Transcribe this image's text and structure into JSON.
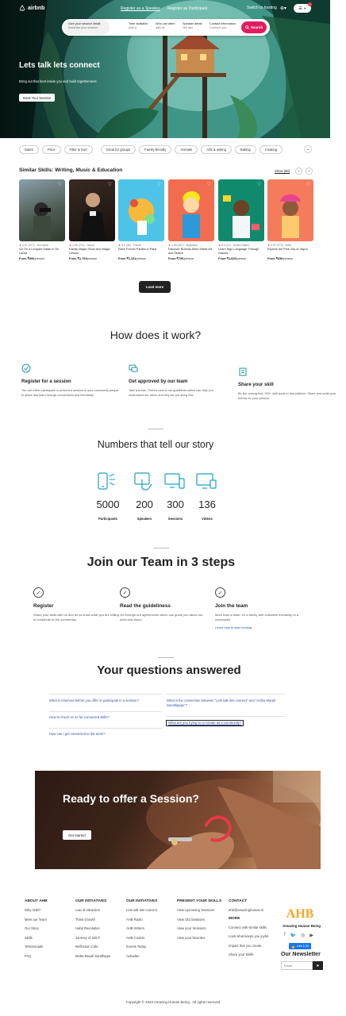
{
  "nav": {
    "logo_text": "airbnb",
    "register_speaker": "Register as a Speaker",
    "register_participant": "Register as Participant",
    "switch_hosting": "Switch to hosting",
    "globe": "⊕",
    "menu": "☰",
    "user": "●"
  },
  "search": {
    "seg1_title": "Give your session detail",
    "seg1_sub": "Describe your session",
    "seg2_title": "Time available",
    "seg2_sub": "Add d",
    "seg3_title": "Who can atten",
    "seg3_sub": "add de",
    "seg4_title": "Speaker detail",
    "seg4_sub": "Tell abo",
    "seg5_title": "Contact information",
    "seg5_sub": "Connect you",
    "button": "Search"
  },
  "hero": {
    "title": "Lets talk lets connect",
    "subtitle": "Bring out that best inside you and build togetherness",
    "button": "Book Your Session"
  },
  "filters": [
    "Dates",
    "Price",
    "Filter & Sort",
    "Great for groups",
    "Family-friendly",
    "Animals",
    "Arts & writing",
    "Baking",
    "Cooking"
  ],
  "similar": {
    "title": "Similar Skills: Writing, Music & Education",
    "show_all": "Show (68)",
    "cards": [
      {
        "meta": "4.97 (377) · Sri Lanka",
        "title": "Go On a Leopard Safari in Sri Lanka",
        "price_bold": "From ₹906",
        "price_rest": "/person"
      },
      {
        "meta": "4.96 (274) · Japan",
        "title": "Family Magic Show And Magic Lesson",
        "price_bold": "From ₹1,793",
        "price_rest": "/person"
      },
      {
        "meta": "5.0 (35) · France",
        "title": "Rave French Parties in Paris",
        "price_bold": "From ₹1,331",
        "price_rest": "/person"
      },
      {
        "meta": "4.98 (287) · Argentina",
        "title": "Discover Buenos Aires Street Art and Sketch",
        "price_bold": "From ₹796",
        "price_rest": "/person"
      },
      {
        "meta": "5.0 (21) · United States",
        "title": "Learn Sign Language Through Games",
        "price_bold": "From ₹1,829",
        "price_rest": "/person"
      },
      {
        "meta": "4.97 (273) · India",
        "title": "Explore the Pink City of Jaipur",
        "price_bold": "From ₹656",
        "price_rest": "/person"
      }
    ],
    "load_more": "Load more"
  },
  "how": {
    "title": "How does it work?",
    "items": [
      {
        "title": "Register for a session",
        "text": "You can either participate or present a session to your community people to share and learn through connections and friendship."
      },
      {
        "title": "Get approved by our team",
        "text": "Take a break. There's next to our guidelines which can help you understand our vision and why we are doing this."
      },
      {
        "title": "Share your skill",
        "text": "Be like among that, 300+ skill spots in this platform. Share and invite your friends for your session."
      }
    ]
  },
  "numbers": {
    "title": "Numbers that tell our story",
    "items": [
      {
        "value": "5000",
        "label": "Participants"
      },
      {
        "value": "200",
        "label": "Speakers"
      },
      {
        "value": "300",
        "label": "Sessions"
      },
      {
        "value": "136",
        "label": "Videos"
      }
    ]
  },
  "join": {
    "title": "Join our Team in 3 steps",
    "steps": [
      {
        "title": "Register",
        "text": "Share your skills with us and let us know what you are willing to contribute to the community."
      },
      {
        "title": "Read the guideliness",
        "text": "Go through our agreements which can guide you about our work and vision."
      },
      {
        "title": "Join the team",
        "text": "More than a team, it's a family with collective friendship in a community",
        "link": "Learn how to start hosting"
      }
    ]
  },
  "faq": {
    "title": "Your questions answered",
    "q1": "What is reserved before you offer or participate in a session?",
    "q2": "What is the connection between \"Lets talk lets connect\" and \"Antha Maadi Sandhipppu\"?",
    "q3": "How to check on so far connected skills?",
    "q4": "What are you trying to co-create as a community?",
    "q5": "How can I get connected to the team?"
  },
  "promo": {
    "title": "Ready to offer a Session?",
    "button": "Get started"
  },
  "footer": {
    "about": {
      "heading": "ABOUT AHB",
      "items": [
        "Why AHB?",
        "Meet our Team",
        "Our Story",
        "Skills",
        "Testimonials",
        "FAQ"
      ]
    },
    "init1": {
      "heading": "OUR INITIATIVES",
      "items": [
        "Law of Attraction",
        "Think Growth",
        "Habit Revolution",
        "Journey of SELF",
        "Reflection Cafe",
        "Motta Maadi Sandhippu"
      ]
    },
    "init2": {
      "heading": "OUR INITIATIVES",
      "items": [
        "Lets talk lets connect",
        "AHB Radio",
        "AHB Writers",
        "AHB Coders",
        "Events Today",
        "Aekadan"
      ]
    },
    "present": {
      "heading": "PRESENT YOUR SKILLS",
      "items": [
        "View Upcoming Sessions",
        "View Old Sessions",
        "View your Sessions",
        "View your favorites"
      ]
    },
    "contact": {
      "heading": "CONTACT",
      "email": "ahb@amazinghuman.in",
      "more_heading": "MORE",
      "items": [
        "Connect with similar skills",
        "Look what keeps you joyful",
        "Impact that you create",
        "Share your Skills"
      ]
    },
    "brand_name": "Amazing Human Being",
    "logo_letters": "AHB",
    "social": [
      "f",
      "🐦",
      "◎",
      "▶"
    ],
    "like": "Like 1.2k",
    "newsletter_title": "Our Newsletter",
    "newsletter_placeholder": "Email",
    "send": "➤",
    "copyright": "Copyright © 2023 Amazing Human Being . All rights reserved"
  },
  "colors": {
    "accent": "#e31c5f",
    "dark": "#222222",
    "teal": "#1d9a9a"
  }
}
